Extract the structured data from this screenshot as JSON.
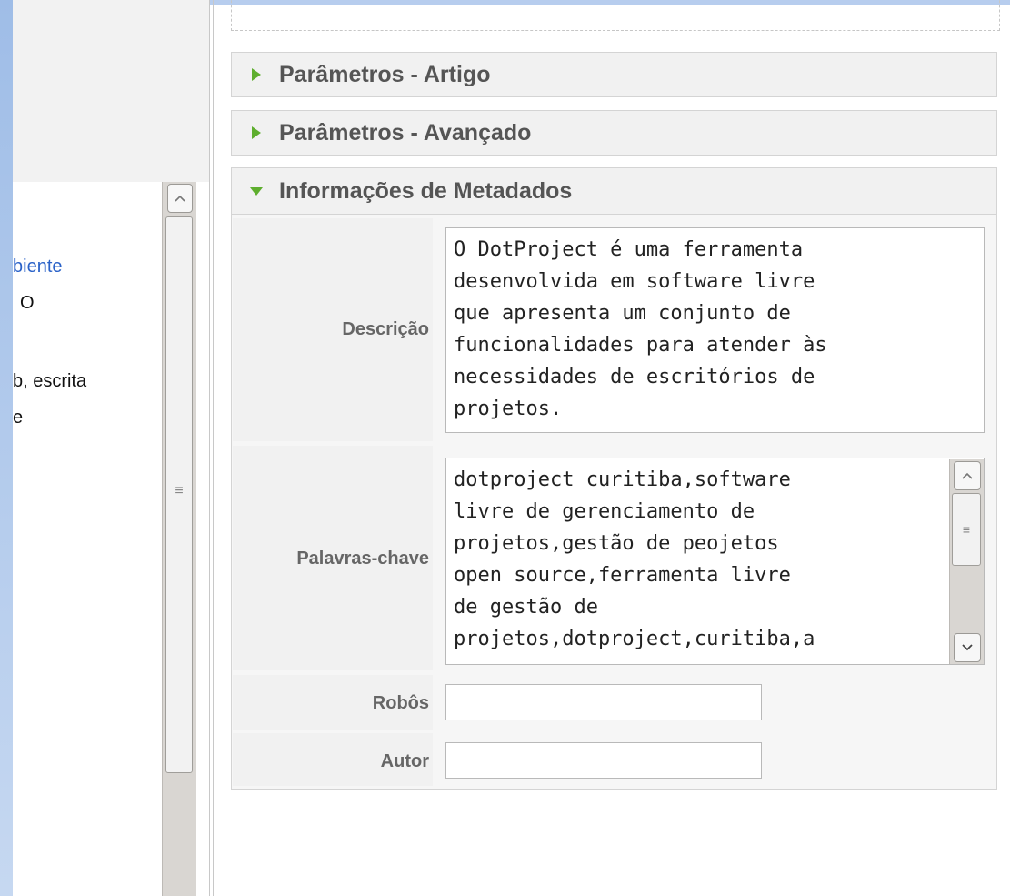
{
  "editor": {
    "visible_lines": [
      "biente",
      "O",
      "b, escrita",
      "e"
    ]
  },
  "panels": {
    "article_params": "Parâmetros - Artigo",
    "advanced_params": "Parâmetros - Avançado",
    "metadata": "Informações de Metadados"
  },
  "metadata_form": {
    "description_label": "Descrição",
    "description_value": "O DotProject é uma ferramenta\ndesenvolvida em software livre\nque apresenta um conjunto de\nfuncionalidades para atender às\nnecessidades de escritórios de\nprojetos.",
    "keywords_label": "Palavras-chave",
    "keywords_value": "dotproject curitiba,software\nlivre de gerenciamento de\nprojetos,gestão de peojetos\nopen source,ferramenta livre\nde gestão de\nprojetos,dotproject,curitiba,a",
    "robots_label": "Robôs",
    "robots_value": "",
    "author_label": "Autor",
    "author_value": ""
  },
  "colors": {
    "accent_arrow": "#5eae2e",
    "link": "#2a62c8",
    "side_strip": "#9fbde7"
  },
  "icons": {
    "scroll_up": "chevron-up-icon",
    "scroll_down": "chevron-down-icon",
    "grip": "grip-lines-icon",
    "expand": "triangle-right-icon",
    "collapse": "triangle-down-icon"
  }
}
